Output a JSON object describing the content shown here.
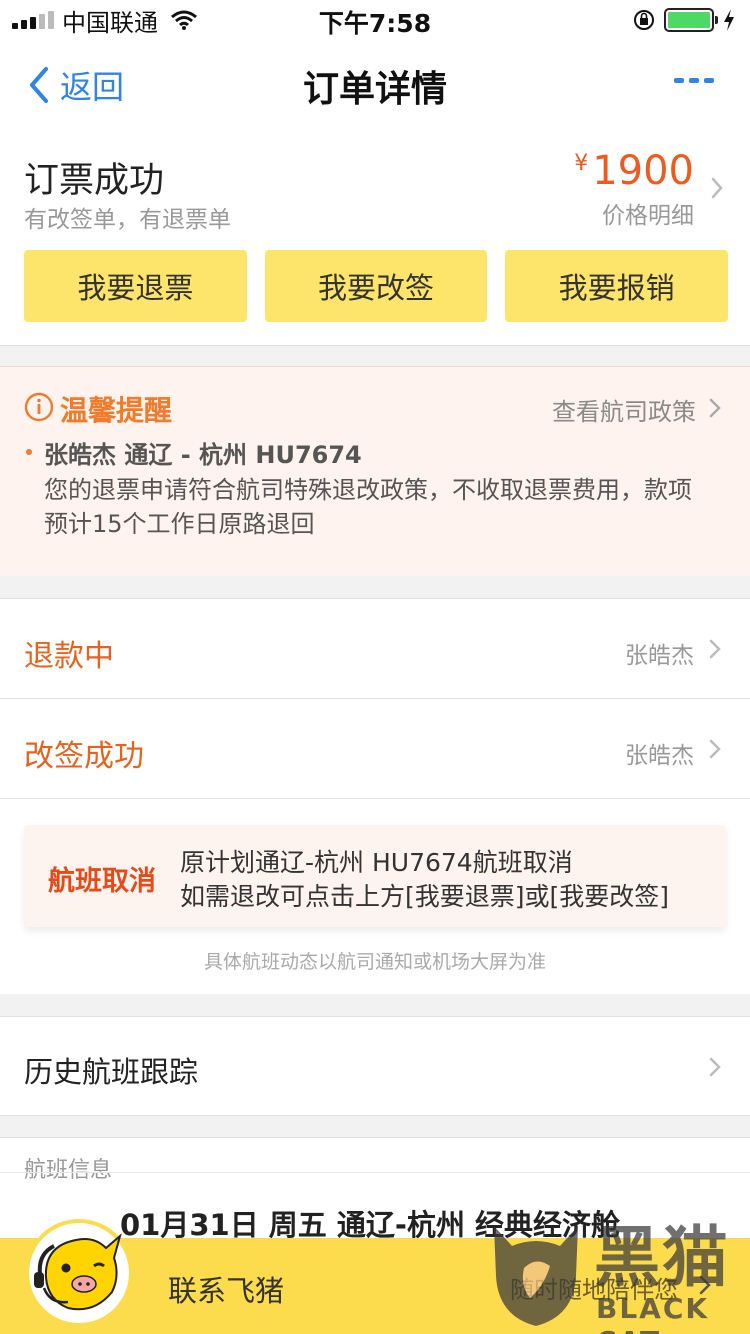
{
  "status_bar": {
    "carrier": "中国联通",
    "time": "下午7:58"
  },
  "nav": {
    "back_label": "返回",
    "title": "订单详情"
  },
  "order": {
    "status": "订票成功",
    "subtitle": "有改签单，有退票单",
    "currency_symbol": "¥",
    "price": "1900",
    "price_detail_label": "价格明细",
    "actions": [
      {
        "label": "我要退票"
      },
      {
        "label": "我要改签"
      },
      {
        "label": "我要报销"
      }
    ]
  },
  "reminder": {
    "title": "温馨提醒",
    "policy_link": "查看航司政策",
    "flight": "张皓杰 通辽 - 杭州 HU7674",
    "text": "您的退票申请符合航司特殊退改政策，不收取退票费用，款项预计15个工作日原路退回"
  },
  "status_rows": [
    {
      "label": "退款中",
      "name": "张皓杰"
    },
    {
      "label": "改签成功",
      "name": "张皓杰"
    }
  ],
  "cancel_notice": {
    "badge": "航班取消",
    "line1": "原计划通辽-杭州 HU7674航班取消",
    "line2": "如需退改可点击上方[我要退票]或[我要改签]",
    "note": "具体航班动态以航司通知或机场大屏为准"
  },
  "history": {
    "label": "历史航班跟踪"
  },
  "flight_info": {
    "header": "航班信息",
    "summary": "01月31日 周五 通辽-杭州 经典经济舱"
  },
  "contact": {
    "label": "联系飞猪",
    "slogan": "随时随地陪伴您"
  },
  "watermark": {
    "cn": "黑猫",
    "en": "BLACK CAT"
  },
  "colors": {
    "accent_blue": "#2f84e5",
    "accent_orange": "#e8621d",
    "button_yellow": "#fde46b",
    "contact_yellow": "#fcdc4d"
  }
}
